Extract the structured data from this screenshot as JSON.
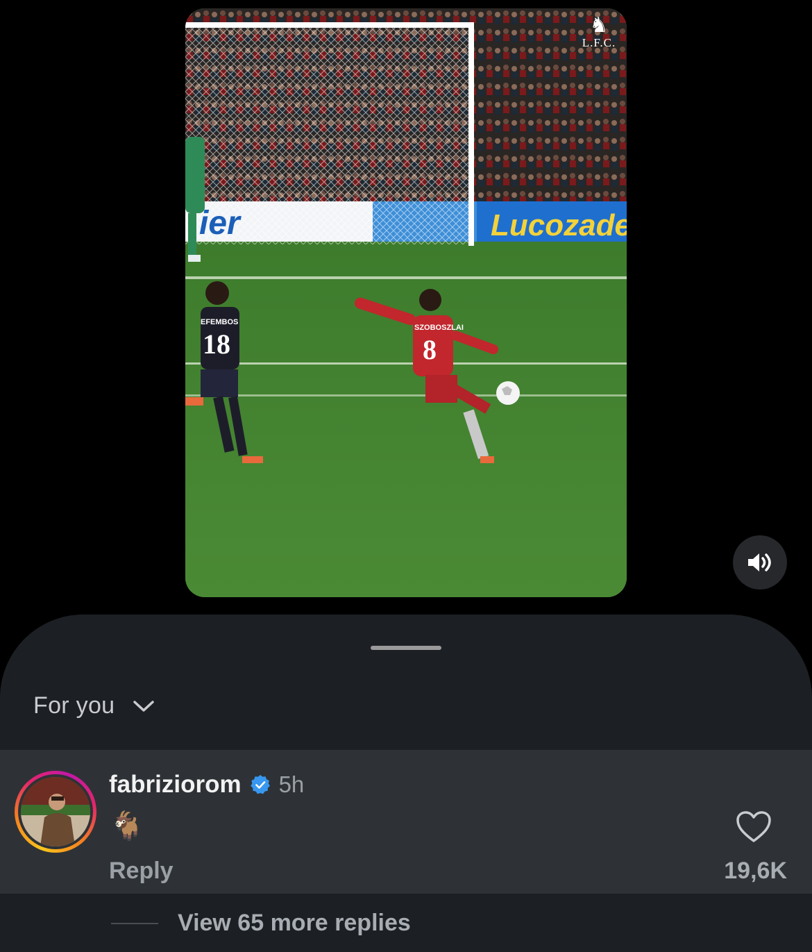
{
  "video": {
    "club_logo_text": "L.F.C.",
    "board_left_text": "ier",
    "board_right_text": "Lucozade",
    "player_left_name": "EFEMBOS",
    "player_left_number": "18",
    "player_right_name": "SZOBOSZLAI",
    "player_right_number": "8",
    "mute_icon": "speaker-icon"
  },
  "sheet": {
    "filter_label": "For you",
    "filter_icon": "chevron-down-icon"
  },
  "comment": {
    "username": "fabriziorom",
    "verified_icon": "verified-badge-icon",
    "time": "5h",
    "body": "🐐",
    "reply_label": "Reply",
    "like_icon": "heart-icon",
    "like_count": "19,6K"
  },
  "more_replies_label": "View 65 more replies",
  "colors": {
    "background": "#000000",
    "sheet": "#1c1f23",
    "comment_highlight": "#2e3236",
    "verified_blue": "#3897f0",
    "pitch_green": "#3f7a2f"
  }
}
